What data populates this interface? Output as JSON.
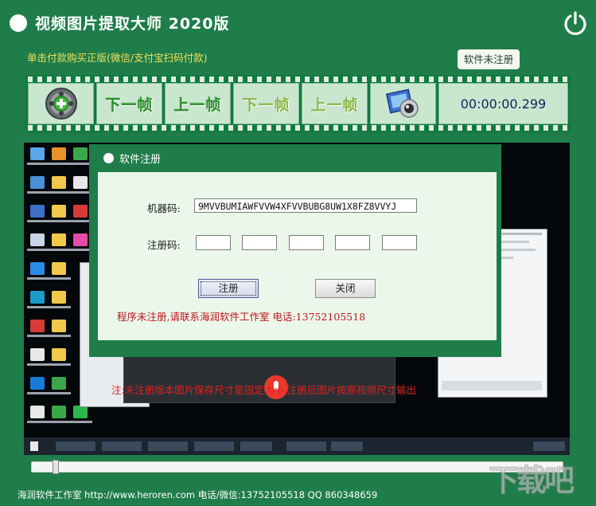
{
  "app": {
    "title": "视频图片提取大师 2020版",
    "buy_link": "单击付款购买正版(微信/支付宝扫码付款)",
    "register_status": "软件未注册"
  },
  "toolbar": {
    "add_icon": "add-video-icon",
    "next_frame_label": "下一帧",
    "prev_frame_label": "上一帧",
    "next_frame_dim_label": "下一帧",
    "prev_frame_dim_label": "上一帧",
    "capture_icon": "photo-capture-icon",
    "timecode": "00:00:00.299"
  },
  "dialog": {
    "title": "软件注册",
    "machine_code_label": "机器码:",
    "machine_code_value": "9MVVBUMIAWFVVW4XFVVBUBG8UW1X8FZ8VVYJ",
    "reg_code_label": "注册码:",
    "reg_code_segments": [
      "",
      "",
      "",
      "",
      ""
    ],
    "register_button": "注册",
    "close_button": "关闭",
    "status_message": "程序未注册,请联系海润软件工作室 电话:13752105518"
  },
  "preview": {
    "note": "注:未注册版本图片保存尺寸是固定大小,注册后图片按原视频尺寸输出"
  },
  "playback": {
    "progress": 0.02
  },
  "footer": {
    "text": "海润软件工作室 http://www.heroren.com 电话/微信:13752105518 QQ 860348659"
  },
  "watermark": {
    "text": "下载吧"
  },
  "colors": {
    "app_green": "#1f7d4a",
    "film_green": "#117a3e",
    "frame_bg": "#c9e7cf",
    "dialog_body": "#ebf7ea",
    "warning_red": "#c0141b",
    "link_yellow": "#f1e15a"
  }
}
